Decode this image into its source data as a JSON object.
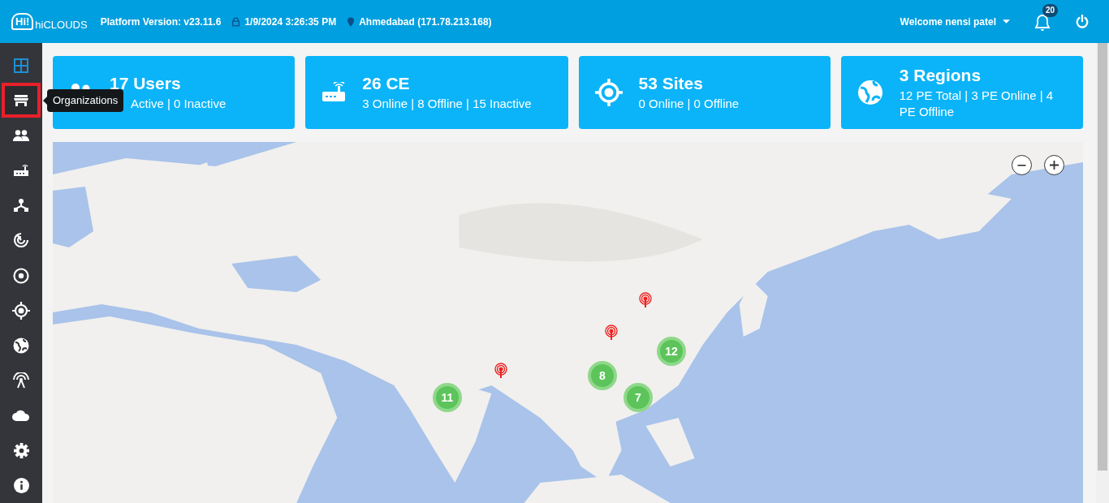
{
  "header": {
    "logo_badge": "Hi!",
    "logo_text": "hiCLOUDS",
    "platform_version": "Platform Version: v23.11.6",
    "datetime": "1/9/2024 3:26:35 PM",
    "location": "Ahmedabad (171.78.213.168)",
    "welcome": "Welcome nensi patel",
    "notification_count": "20"
  },
  "sidebar": {
    "items": [
      {
        "kind": "dashboard",
        "selected": true,
        "highlighted": false
      },
      {
        "kind": "organizations",
        "selected": false,
        "highlighted": true
      },
      {
        "kind": "users",
        "selected": false,
        "highlighted": false
      },
      {
        "kind": "router",
        "selected": false,
        "highlighted": false
      },
      {
        "kind": "topology",
        "selected": false,
        "highlighted": false
      },
      {
        "kind": "radar",
        "selected": false,
        "highlighted": false
      },
      {
        "kind": "circle",
        "selected": false,
        "highlighted": false
      },
      {
        "kind": "target",
        "selected": false,
        "highlighted": false
      },
      {
        "kind": "globe",
        "selected": false,
        "highlighted": false
      },
      {
        "kind": "antenna",
        "selected": false,
        "highlighted": false
      },
      {
        "kind": "cloud",
        "selected": false,
        "highlighted": false
      },
      {
        "kind": "settings",
        "selected": false,
        "highlighted": false
      },
      {
        "kind": "info",
        "selected": false,
        "highlighted": false
      }
    ],
    "tooltip": "Organizations"
  },
  "cards": [
    {
      "kind": "users",
      "title": "17 Users",
      "subtitle": "Active | 0 Inactive"
    },
    {
      "kind": "router",
      "title": "26 CE",
      "subtitle": "3 Online | 8 Offline | 15 Inactive"
    },
    {
      "kind": "target",
      "title": "53 Sites",
      "subtitle": "0 Online | 0 Offline"
    },
    {
      "kind": "globe",
      "title": "3 Regions",
      "subtitle": "12 PE Total | 3 PE Online | 4 PE Offline"
    }
  ],
  "map": {
    "kind": "picture",
    "clusters": [
      {
        "count": "12"
      },
      {
        "count": "8"
      },
      {
        "count": "11"
      },
      {
        "count": "7"
      }
    ],
    "pins": [
      {
        "kind": "signal"
      },
      {
        "kind": "signal"
      },
      {
        "kind": "signal"
      }
    ]
  }
}
